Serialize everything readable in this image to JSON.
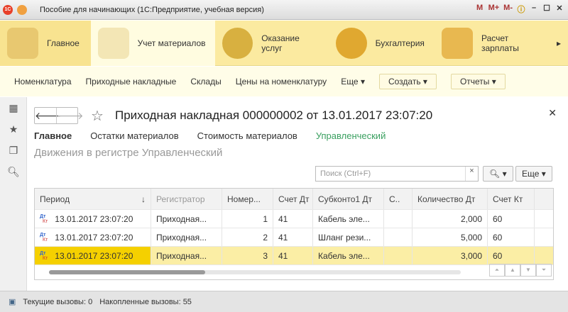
{
  "window": {
    "title": "Пособие для начинающих  (1С:Предприятие, учебная версия)",
    "buttons": [
      "M",
      "M+",
      "M-"
    ]
  },
  "sections": [
    {
      "label": "Главное"
    },
    {
      "label": "Учет материалов"
    },
    {
      "label": "Оказание услуг"
    },
    {
      "label": "Бухгалтерия"
    },
    {
      "label": "Расчет зарплаты"
    }
  ],
  "panel": {
    "links": [
      "Номенклатура",
      "Приходные накладные",
      "Склады",
      "Цены на номенклатуру",
      "Еще ▾"
    ],
    "create": "Создать ▾",
    "reports": "Отчеты ▾"
  },
  "doc": {
    "title": "Приходная накладная 000000002 от 13.01.2017 23:07:20",
    "tabs": [
      "Главное",
      "Остатки материалов",
      "Стоимость материалов",
      "Управленческий"
    ],
    "subheading": "Движения в регистре Управленческий",
    "search_placeholder": "Поиск (Ctrl+F)",
    "more": "Еще ▾"
  },
  "table": {
    "columns": [
      "Период",
      "Регистратор",
      "Номер...",
      "Счет Дт",
      "Субконто1 Дт",
      "С..",
      "Количество Дт",
      "Счет Кт"
    ],
    "rows": [
      [
        "13.01.2017 23:07:20",
        "Приходная...",
        "1",
        "41",
        "Кабель эле...",
        "",
        "2,000",
        "60"
      ],
      [
        "13.01.2017 23:07:20",
        "Приходная...",
        "2",
        "41",
        "Шланг рези...",
        "",
        "5,000",
        "60"
      ],
      [
        "13.01.2017 23:07:20",
        "Приходная...",
        "3",
        "41",
        "Кабель эле...",
        "",
        "3,000",
        "60"
      ]
    ],
    "dk": "Дт",
    "kt": "Кт"
  },
  "status": {
    "current": "Текущие вызовы: 0",
    "accumulated": "Накопленные вызовы: 55"
  }
}
